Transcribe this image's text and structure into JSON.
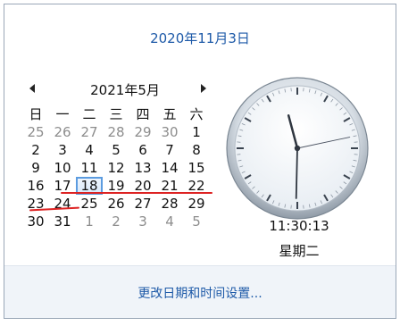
{
  "header": {
    "date": "2020年11月3日"
  },
  "calendar": {
    "month_title": "2021年5月",
    "weekdays": [
      "日",
      "一",
      "二",
      "三",
      "四",
      "五",
      "六"
    ],
    "weeks": [
      [
        {
          "d": "25",
          "o": true
        },
        {
          "d": "26",
          "o": true
        },
        {
          "d": "27",
          "o": true
        },
        {
          "d": "28",
          "o": true
        },
        {
          "d": "29",
          "o": true
        },
        {
          "d": "30",
          "o": true
        },
        {
          "d": "1",
          "o": false
        }
      ],
      [
        {
          "d": "2",
          "o": false
        },
        {
          "d": "3",
          "o": false
        },
        {
          "d": "4",
          "o": false
        },
        {
          "d": "5",
          "o": false
        },
        {
          "d": "6",
          "o": false
        },
        {
          "d": "7",
          "o": false
        },
        {
          "d": "8",
          "o": false
        }
      ],
      [
        {
          "d": "9",
          "o": false
        },
        {
          "d": "10",
          "o": false
        },
        {
          "d": "11",
          "o": false
        },
        {
          "d": "12",
          "o": false
        },
        {
          "d": "13",
          "o": false
        },
        {
          "d": "14",
          "o": false
        },
        {
          "d": "15",
          "o": false
        }
      ],
      [
        {
          "d": "16",
          "o": false
        },
        {
          "d": "17",
          "o": false
        },
        {
          "d": "18",
          "o": false,
          "today": true
        },
        {
          "d": "19",
          "o": false
        },
        {
          "d": "20",
          "o": false
        },
        {
          "d": "21",
          "o": false
        },
        {
          "d": "22",
          "o": false
        }
      ],
      [
        {
          "d": "23",
          "o": false
        },
        {
          "d": "24",
          "o": false
        },
        {
          "d": "25",
          "o": false
        },
        {
          "d": "26",
          "o": false
        },
        {
          "d": "27",
          "o": false
        },
        {
          "d": "28",
          "o": false
        },
        {
          "d": "29",
          "o": false
        }
      ],
      [
        {
          "d": "30",
          "o": false
        },
        {
          "d": "31",
          "o": false
        },
        {
          "d": "1",
          "o": true
        },
        {
          "d": "2",
          "o": true
        },
        {
          "d": "3",
          "o": true
        },
        {
          "d": "4",
          "o": true
        },
        {
          "d": "5",
          "o": true
        }
      ]
    ],
    "prev_icon": "chevron-left-icon",
    "next_icon": "chevron-right-icon"
  },
  "clock": {
    "time": "11:30:13",
    "day_name": "星期二",
    "hour": 11,
    "minute": 30,
    "second": 13
  },
  "footer": {
    "link": "更改日期和时间设置..."
  },
  "colors": {
    "accent": "#1e5aa8",
    "underline": "#dd2222",
    "other_month": "#8d8d8d",
    "today_border": "#5c9ce0"
  }
}
